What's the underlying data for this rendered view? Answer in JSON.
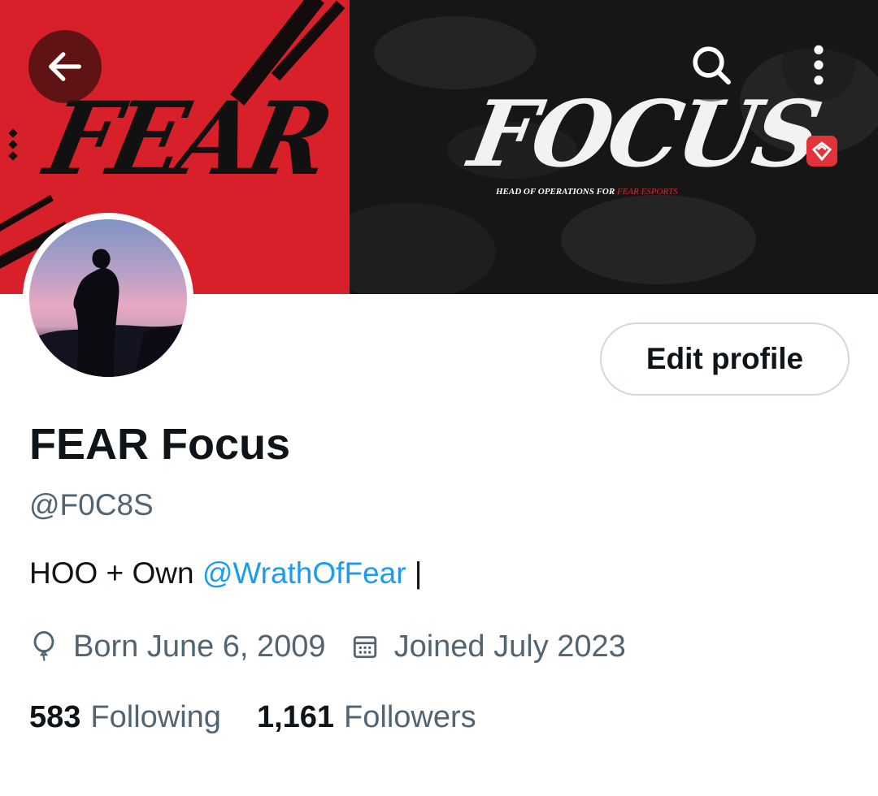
{
  "header": {
    "back_icon": "arrow-left-icon",
    "search_icon": "search-icon",
    "more_icon": "more-vertical-icon"
  },
  "banner": {
    "left_word": "FEAR",
    "right_word": "FOCUS",
    "tagline_main": "HEAD OF OPERATIONS FOR ",
    "tagline_accent": "FEAR ESPORTS",
    "colors": {
      "red": "#d8202a",
      "dark": "#161616"
    }
  },
  "profile": {
    "edit_label": "Edit profile",
    "display_name": "FEAR Focus",
    "handle": "@F0C8S",
    "bio_prefix": "HOO + Own ",
    "bio_mention": "@WrathOfFear",
    "bio_suffix": " |",
    "born": "Born June 6, 2009",
    "joined": "Joined July 2023",
    "following_count": "583",
    "following_label": "Following",
    "followers_count": "1,161",
    "followers_label": "Followers",
    "accent_color": "#1d9bf0"
  }
}
